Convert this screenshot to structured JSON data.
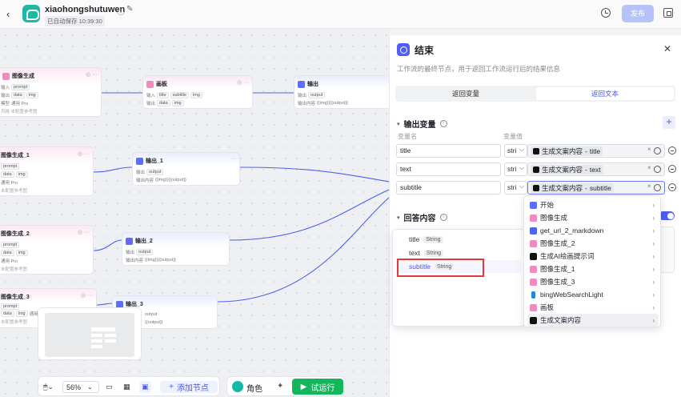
{
  "topbar": {
    "app_name": "xiaohongshutuwen",
    "saved_status": "已自动保存 10:39:30",
    "publish_label": "发布"
  },
  "nodes": {
    "img_gen": {
      "title": "图像生成",
      "in_label": "输入",
      "in_chip": "prompt",
      "out_label": "输出",
      "out_chip1": "data",
      "out_chip2": "img",
      "model_label": "模型",
      "model": "通用 Pro",
      "extra": "风格  未配置参考图"
    },
    "board": {
      "title": "画板",
      "in_label": "输入",
      "chip1": "title",
      "chip2": "subtitle",
      "chip3": "img",
      "out_label": "输出",
      "chip4": "data",
      "chip5": "img"
    },
    "output_top": {
      "title": "输出",
      "label1": "输出",
      "chip": "output",
      "label2": "输出内容",
      "content": "{{img}}{{output}}"
    },
    "img_gen_1": {
      "title": "图像生成_1",
      "in_chip": "prompt",
      "out_chip1": "data",
      "out_chip2": "img",
      "model": "通用 Pro",
      "extra": "未配置参考图"
    },
    "output_1": {
      "title": "输出_1",
      "label1": "输出",
      "chip": "output",
      "label2": "输出内容",
      "content": "{{img}}{{output}}"
    },
    "img_gen_2": {
      "title": "图像生成_2",
      "in_chip": "prompt",
      "out_chip1": "data",
      "out_chip2": "img",
      "model": "通用 Pro",
      "extra": "未配置参考图"
    },
    "output_2": {
      "title": "输出_2",
      "label1": "输出",
      "chip": "output",
      "label2": "输出内容",
      "content": "{{img}}{{output}}"
    },
    "img_gen_3": {
      "title": "图像生成_3",
      "in_chip": "prompt",
      "out_chip1": "data",
      "out_chip2": "img",
      "model": "通用 Pro",
      "extra": "未配置参考图"
    },
    "output_3": {
      "title": "输出_3",
      "chip": "output",
      "content": "{{output}}"
    }
  },
  "bottombar": {
    "zoom": "56%",
    "add_node": "添加节点",
    "role": "角色",
    "run": "试运行"
  },
  "panel": {
    "title": "结束",
    "description": "工作流的最终节点，用于返回工作流运行后的结果信息",
    "tabs": [
      "返回变量",
      "返回文本"
    ],
    "active_tab": 1,
    "section_output": "输出变量",
    "col_name": "变量名",
    "col_value": "变量值",
    "rows": [
      {
        "name": "title",
        "type": "stri",
        "source": "生成文案内容",
        "field": "title"
      },
      {
        "name": "text",
        "type": "stri",
        "source": "生成文案内容",
        "field": "text"
      },
      {
        "name": "subtitle",
        "type": "stri",
        "source": "生成文案内容",
        "field": "subtitle"
      }
    ],
    "section_answer": "回答内容"
  },
  "dropdown": {
    "items": [
      {
        "label": "开始",
        "color": "#5b6cff"
      },
      {
        "label": "图像生成",
        "color": "#f08bc2"
      },
      {
        "label": "get_url_2_markdown",
        "color": "#4c63f0"
      },
      {
        "label": "图像生成_2",
        "color": "#f08bc2"
      },
      {
        "label": "生成AI绘画提示词",
        "color": "#111111"
      },
      {
        "label": "图像生成_1",
        "color": "#f08bc2"
      },
      {
        "label": "图像生成_3",
        "color": "#f08bc2"
      },
      {
        "label": "bingWebSearchLight",
        "color": "#1e88e5"
      },
      {
        "label": "画板",
        "color": "#f08bc2"
      },
      {
        "label": "生成文案内容",
        "color": "#111111"
      }
    ],
    "selected_index": 9
  },
  "popup": {
    "items": [
      {
        "name": "title",
        "type": "String"
      },
      {
        "name": "text",
        "type": "String"
      },
      {
        "name": "subtitle",
        "type": "String"
      }
    ],
    "selected_index": 2
  }
}
